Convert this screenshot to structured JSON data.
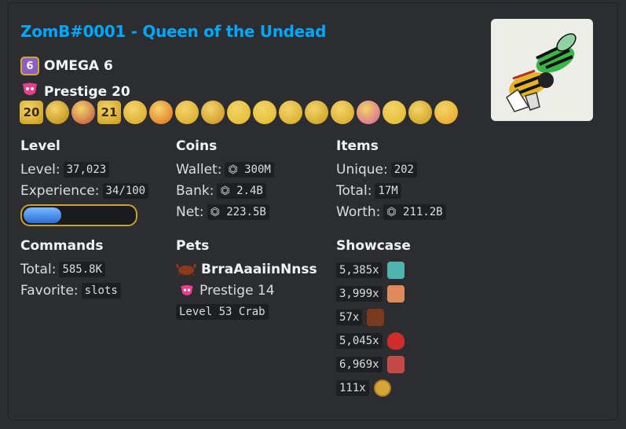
{
  "title": "ZomB#0001 - Queen of the Undead",
  "omega": {
    "badge_number": "6",
    "label": "OMEGA 6"
  },
  "prestige": {
    "label": "Prestige 20"
  },
  "badges": [
    {
      "text": "20",
      "color": "#c99a17"
    },
    {
      "text": "",
      "color": "#b8860b"
    },
    {
      "text": "",
      "color": "#c24b3c"
    },
    {
      "text": "21",
      "color": "#c99a17"
    },
    {
      "text": "",
      "color": "#d6a520"
    },
    {
      "text": "",
      "color": "#e06a1b"
    },
    {
      "text": "",
      "color": "#d6a520"
    },
    {
      "text": "",
      "color": "#c98c1a"
    },
    {
      "text": "",
      "color": "#e2b824"
    },
    {
      "text": "",
      "color": "#e2b824"
    },
    {
      "text": "",
      "color": "#d6a520"
    },
    {
      "text": "",
      "color": "#c99a17"
    },
    {
      "text": "",
      "color": "#d6a520"
    },
    {
      "text": "",
      "color": "#d65a9b"
    },
    {
      "text": "",
      "color": "#e2b824"
    },
    {
      "text": "",
      "color": "#c99a17"
    },
    {
      "text": "",
      "color": "#e8a31c"
    }
  ],
  "level": {
    "heading": "Level",
    "level_label": "Level:",
    "level_value": "37,023",
    "exp_label": "Experience:",
    "exp_value": "34/100",
    "progress": 0.34
  },
  "coins": {
    "heading": "Coins",
    "wallet_label": "Wallet:",
    "wallet_value": "⏣ 300M",
    "bank_label": "Bank:",
    "bank_value": "⏣ 2.4B",
    "net_label": "Net:",
    "net_value": "⏣ 223.5B"
  },
  "items": {
    "heading": "Items",
    "unique_label": "Unique:",
    "unique_value": "202",
    "total_label": "Total:",
    "total_value": "17M",
    "worth_label": "Worth:",
    "worth_value": "⏣ 211.2B"
  },
  "commands": {
    "heading": "Commands",
    "total_label": "Total:",
    "total_value": "585.8K",
    "favorite_label": "Favorite:",
    "favorite_value": "slots"
  },
  "pets": {
    "heading": "Pets",
    "name": "BrraAaaiinNnss",
    "prestige": "Prestige 14",
    "level": "Level 53 Crab"
  },
  "showcase": {
    "heading": "Showcase",
    "items": [
      {
        "count": "5,385x",
        "icon": "treasure-chest-icon",
        "color": "#4fb3b0"
      },
      {
        "count": "3,999x",
        "icon": "pizza-icon",
        "color": "#e08a5a"
      },
      {
        "count": "57x",
        "icon": "bear-icon",
        "color": "#7a3a1e"
      },
      {
        "count": "5,045x",
        "icon": "heart-potion-icon",
        "color": "#d12b2b"
      },
      {
        "count": "6,969x",
        "icon": "meat-icon",
        "color": "#c44a4a"
      },
      {
        "count": "111x",
        "icon": "omega-coin-icon",
        "color": "#d7a63a"
      }
    ]
  }
}
